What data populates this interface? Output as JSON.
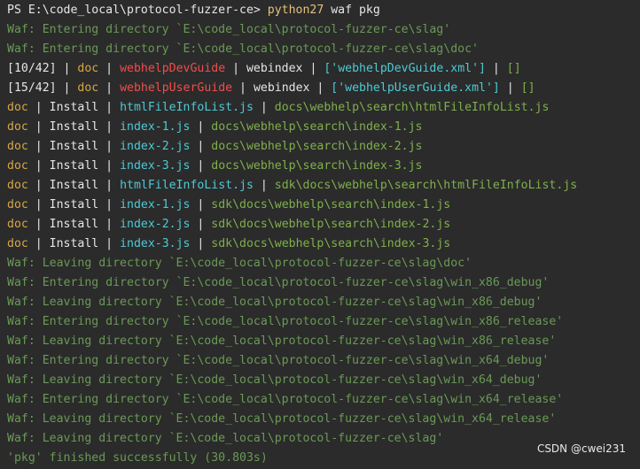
{
  "lines": [
    [
      {
        "t": "PS E:\\code_local\\protocol-fuzzer-ce> ",
        "c": "white"
      },
      {
        "t": "python27",
        "c": "yellow"
      },
      {
        "t": " waf pkg",
        "c": "white"
      }
    ],
    [
      {
        "t": "Waf: Entering directory `E:\\code_local\\protocol-fuzzer-ce\\slag'",
        "c": "green"
      }
    ],
    [
      {
        "t": "Waf: Entering directory `E:\\code_local\\protocol-fuzzer-ce\\slag\\doc'",
        "c": "green"
      }
    ],
    [
      {
        "t": "[10/42]",
        "c": "white"
      },
      {
        "t": " | ",
        "c": "white"
      },
      {
        "t": "doc",
        "c": "orange"
      },
      {
        "t": " | ",
        "c": "white"
      },
      {
        "t": "webhelpDevGuide",
        "c": "red"
      },
      {
        "t": " | ",
        "c": "white"
      },
      {
        "t": "webindex",
        "c": "white"
      },
      {
        "t": " | ",
        "c": "white"
      },
      {
        "t": "['webhelpDevGuide.xml']",
        "c": "cyan"
      },
      {
        "t": " | ",
        "c": "white"
      },
      {
        "t": "[]",
        "c": "dkgreen"
      }
    ],
    [
      {
        "t": "[15/42]",
        "c": "white"
      },
      {
        "t": " | ",
        "c": "white"
      },
      {
        "t": "doc",
        "c": "orange"
      },
      {
        "t": " | ",
        "c": "white"
      },
      {
        "t": "webhelpUserGuide",
        "c": "red"
      },
      {
        "t": " | ",
        "c": "white"
      },
      {
        "t": "webindex",
        "c": "white"
      },
      {
        "t": " | ",
        "c": "white"
      },
      {
        "t": "['webhelpUserGuide.xml']",
        "c": "cyan"
      },
      {
        "t": " | ",
        "c": "white"
      },
      {
        "t": "[]",
        "c": "dkgreen"
      }
    ],
    [
      {
        "t": "doc",
        "c": "orange"
      },
      {
        "t": " | ",
        "c": "white"
      },
      {
        "t": "Install",
        "c": "white"
      },
      {
        "t": " | ",
        "c": "white"
      },
      {
        "t": "htmlFileInfoList.js",
        "c": "cyan"
      },
      {
        "t": " | ",
        "c": "white"
      },
      {
        "t": "docs\\webhelp\\search\\htmlFileInfoList.js",
        "c": "dkgreen"
      }
    ],
    [
      {
        "t": "doc",
        "c": "orange"
      },
      {
        "t": " | ",
        "c": "white"
      },
      {
        "t": "Install",
        "c": "white"
      },
      {
        "t": " | ",
        "c": "white"
      },
      {
        "t": "index-1.js",
        "c": "cyan"
      },
      {
        "t": " | ",
        "c": "white"
      },
      {
        "t": "docs\\webhelp\\search\\index-1.js",
        "c": "dkgreen"
      }
    ],
    [
      {
        "t": "doc",
        "c": "orange"
      },
      {
        "t": " | ",
        "c": "white"
      },
      {
        "t": "Install",
        "c": "white"
      },
      {
        "t": " | ",
        "c": "white"
      },
      {
        "t": "index-2.js",
        "c": "cyan"
      },
      {
        "t": " | ",
        "c": "white"
      },
      {
        "t": "docs\\webhelp\\search\\index-2.js",
        "c": "dkgreen"
      }
    ],
    [
      {
        "t": "doc",
        "c": "orange"
      },
      {
        "t": " | ",
        "c": "white"
      },
      {
        "t": "Install",
        "c": "white"
      },
      {
        "t": " | ",
        "c": "white"
      },
      {
        "t": "index-3.js",
        "c": "cyan"
      },
      {
        "t": " | ",
        "c": "white"
      },
      {
        "t": "docs\\webhelp\\search\\index-3.js",
        "c": "dkgreen"
      }
    ],
    [
      {
        "t": "doc",
        "c": "orange"
      },
      {
        "t": " | ",
        "c": "white"
      },
      {
        "t": "Install",
        "c": "white"
      },
      {
        "t": " | ",
        "c": "white"
      },
      {
        "t": "htmlFileInfoList.js",
        "c": "cyan"
      },
      {
        "t": " | ",
        "c": "white"
      },
      {
        "t": "sdk\\docs\\webhelp\\search\\htmlFileInfoList.js",
        "c": "dkgreen"
      }
    ],
    [
      {
        "t": "doc",
        "c": "orange"
      },
      {
        "t": " | ",
        "c": "white"
      },
      {
        "t": "Install",
        "c": "white"
      },
      {
        "t": " | ",
        "c": "white"
      },
      {
        "t": "index-1.js",
        "c": "cyan"
      },
      {
        "t": " | ",
        "c": "white"
      },
      {
        "t": "sdk\\docs\\webhelp\\search\\index-1.js",
        "c": "dkgreen"
      }
    ],
    [
      {
        "t": "doc",
        "c": "orange"
      },
      {
        "t": " | ",
        "c": "white"
      },
      {
        "t": "Install",
        "c": "white"
      },
      {
        "t": " | ",
        "c": "white"
      },
      {
        "t": "index-2.js",
        "c": "cyan"
      },
      {
        "t": " | ",
        "c": "white"
      },
      {
        "t": "sdk\\docs\\webhelp\\search\\index-2.js",
        "c": "dkgreen"
      }
    ],
    [
      {
        "t": "doc",
        "c": "orange"
      },
      {
        "t": " | ",
        "c": "white"
      },
      {
        "t": "Install",
        "c": "white"
      },
      {
        "t": " | ",
        "c": "white"
      },
      {
        "t": "index-3.js",
        "c": "cyan"
      },
      {
        "t": " | ",
        "c": "white"
      },
      {
        "t": "sdk\\docs\\webhelp\\search\\index-3.js",
        "c": "dkgreen"
      }
    ],
    [
      {
        "t": "Waf: Leaving directory `E:\\code_local\\protocol-fuzzer-ce\\slag\\doc'",
        "c": "green"
      }
    ],
    [
      {
        "t": "Waf: Entering directory `E:\\code_local\\protocol-fuzzer-ce\\slag\\win_x86_debug'",
        "c": "green"
      }
    ],
    [
      {
        "t": "Waf: Leaving directory `E:\\code_local\\protocol-fuzzer-ce\\slag\\win_x86_debug'",
        "c": "green"
      }
    ],
    [
      {
        "t": "Waf: Entering directory `E:\\code_local\\protocol-fuzzer-ce\\slag\\win_x86_release'",
        "c": "green"
      }
    ],
    [
      {
        "t": "Waf: Leaving directory `E:\\code_local\\protocol-fuzzer-ce\\slag\\win_x86_release'",
        "c": "green"
      }
    ],
    [
      {
        "t": "Waf: Entering directory `E:\\code_local\\protocol-fuzzer-ce\\slag\\win_x64_debug'",
        "c": "green"
      }
    ],
    [
      {
        "t": "Waf: Leaving directory `E:\\code_local\\protocol-fuzzer-ce\\slag\\win_x64_debug'",
        "c": "green"
      }
    ],
    [
      {
        "t": "Waf: Entering directory `E:\\code_local\\protocol-fuzzer-ce\\slag\\win_x64_release'",
        "c": "green"
      }
    ],
    [
      {
        "t": "Waf: Leaving directory `E:\\code_local\\protocol-fuzzer-ce\\slag\\win_x64_release'",
        "c": "green"
      }
    ],
    [
      {
        "t": "Waf: Leaving directory `E:\\code_local\\protocol-fuzzer-ce\\slag'",
        "c": "green"
      }
    ],
    [
      {
        "t": "'pkg' finished successfully (30.803s)",
        "c": "green"
      }
    ]
  ],
  "watermark": "CSDN @cwei231",
  "colors": {
    "background": "#2b2b2b",
    "white": "#e6e6e6",
    "yellow": "#e5c07b",
    "green": "#6a9955",
    "cyan": "#4ec9d4",
    "red": "#f14c4c",
    "dkgreen": "#7fb04b",
    "orange": "#d7a745"
  }
}
